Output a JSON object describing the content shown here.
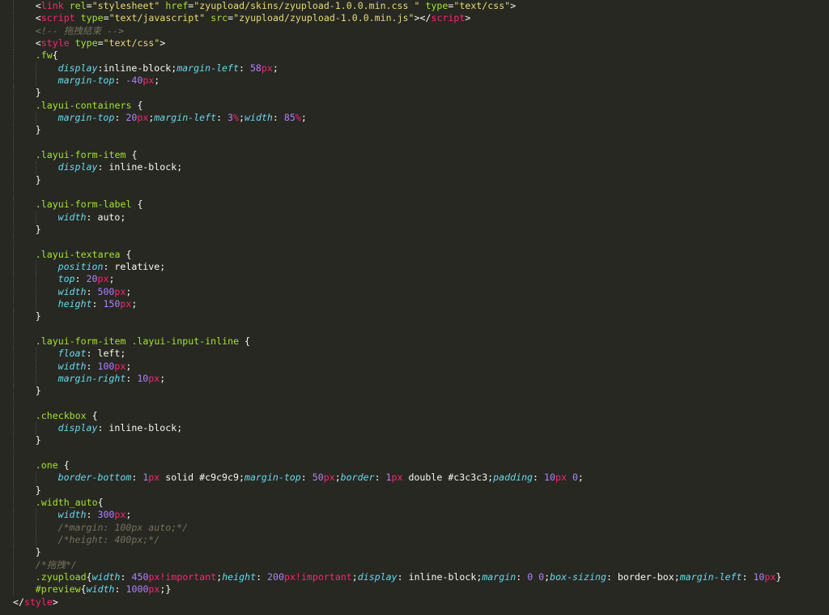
{
  "editor": {
    "theme": "monokai",
    "colors": {
      "background": "#272822",
      "text": "#f8f8f2",
      "tag": "#f92672",
      "attribute": "#a6e22e",
      "string": "#e6db74",
      "comment": "#75715e",
      "property": "#66d9ef",
      "number": "#ae81ff",
      "unit": "#f92672"
    }
  },
  "code_lines": [
    {
      "indent": 1,
      "tokens": [
        [
          "p",
          "<"
        ],
        [
          "t",
          "link"
        ],
        [
          "p",
          " "
        ],
        [
          "a",
          "rel"
        ],
        [
          "p",
          "="
        ],
        [
          "s",
          "\"stylesheet\""
        ],
        [
          "p",
          " "
        ],
        [
          "a",
          "href"
        ],
        [
          "p",
          "="
        ],
        [
          "s",
          "\"zyupload/skins/zyupload-1.0.0.min.css \""
        ],
        [
          "p",
          " "
        ],
        [
          "a",
          "type"
        ],
        [
          "p",
          "="
        ],
        [
          "s",
          "\"text/css\""
        ],
        [
          "p",
          ">"
        ]
      ]
    },
    {
      "indent": 1,
      "tokens": [
        [
          "p",
          "<"
        ],
        [
          "t",
          "script"
        ],
        [
          "p",
          " "
        ],
        [
          "a",
          "type"
        ],
        [
          "p",
          "="
        ],
        [
          "s",
          "\"text/javascript\""
        ],
        [
          "p",
          " "
        ],
        [
          "a",
          "src"
        ],
        [
          "p",
          "="
        ],
        [
          "s",
          "\"zyupload/zyupload-1.0.0.min.js\""
        ],
        [
          "p",
          "></"
        ],
        [
          "t",
          "script"
        ],
        [
          "p",
          ">"
        ]
      ]
    },
    {
      "indent": 1,
      "tokens": [
        [
          "c",
          "<!-- 拖拽結束 -->"
        ]
      ]
    },
    {
      "indent": 1,
      "tokens": [
        [
          "p",
          "<"
        ],
        [
          "t",
          "style"
        ],
        [
          "p",
          " "
        ],
        [
          "a",
          "type"
        ],
        [
          "p",
          "="
        ],
        [
          "s",
          "\"text/css\""
        ],
        [
          "p",
          ">"
        ]
      ]
    },
    {
      "indent": 1,
      "tokens": [
        [
          "a",
          ".fw"
        ],
        [
          "p",
          "{"
        ]
      ]
    },
    {
      "indent": 2,
      "tokens": [
        [
          "k",
          "display"
        ],
        [
          "p",
          ":inline-block;"
        ],
        [
          "k",
          "margin-left"
        ],
        [
          "p",
          ": "
        ],
        [
          "n",
          "58"
        ],
        [
          "u",
          "px"
        ],
        [
          "p",
          ";"
        ]
      ]
    },
    {
      "indent": 2,
      "tokens": [
        [
          "k",
          "margin-top"
        ],
        [
          "p",
          ": "
        ],
        [
          "n",
          "-40"
        ],
        [
          "u",
          "px"
        ],
        [
          "p",
          ";"
        ]
      ]
    },
    {
      "indent": 1,
      "tokens": [
        [
          "p",
          "}"
        ]
      ]
    },
    {
      "indent": 1,
      "tokens": [
        [
          "a",
          ".layui-containers"
        ],
        [
          "p",
          " {"
        ]
      ]
    },
    {
      "indent": 2,
      "tokens": [
        [
          "k",
          "margin-top"
        ],
        [
          "p",
          ": "
        ],
        [
          "n",
          "20"
        ],
        [
          "u",
          "px"
        ],
        [
          "p",
          ";"
        ],
        [
          "k",
          "margin-left"
        ],
        [
          "p",
          ": "
        ],
        [
          "n",
          "3"
        ],
        [
          "u",
          "%"
        ],
        [
          "p",
          ";"
        ],
        [
          "k",
          "width"
        ],
        [
          "p",
          ": "
        ],
        [
          "n",
          "85"
        ],
        [
          "u",
          "%"
        ],
        [
          "p",
          ";"
        ]
      ]
    },
    {
      "indent": 1,
      "tokens": [
        [
          "p",
          "}"
        ]
      ]
    },
    {
      "indent": 1,
      "tokens": []
    },
    {
      "indent": 1,
      "tokens": [
        [
          "a",
          ".layui-form-item"
        ],
        [
          "p",
          " {"
        ]
      ]
    },
    {
      "indent": 2,
      "tokens": [
        [
          "k",
          "display"
        ],
        [
          "p",
          ": inline-block;"
        ]
      ]
    },
    {
      "indent": 1,
      "tokens": [
        [
          "p",
          "}"
        ]
      ]
    },
    {
      "indent": 1,
      "tokens": []
    },
    {
      "indent": 1,
      "tokens": [
        [
          "a",
          ".layui-form-label"
        ],
        [
          "p",
          " {"
        ]
      ]
    },
    {
      "indent": 2,
      "tokens": [
        [
          "k",
          "width"
        ],
        [
          "p",
          ": auto;"
        ]
      ]
    },
    {
      "indent": 1,
      "tokens": [
        [
          "p",
          "}"
        ]
      ]
    },
    {
      "indent": 1,
      "tokens": []
    },
    {
      "indent": 1,
      "tokens": [
        [
          "a",
          ".layui-textarea"
        ],
        [
          "p",
          " {"
        ]
      ]
    },
    {
      "indent": 2,
      "tokens": [
        [
          "k",
          "position"
        ],
        [
          "p",
          ": relative;"
        ]
      ]
    },
    {
      "indent": 2,
      "tokens": [
        [
          "k",
          "top"
        ],
        [
          "p",
          ": "
        ],
        [
          "n",
          "20"
        ],
        [
          "u",
          "px"
        ],
        [
          "p",
          ";"
        ]
      ]
    },
    {
      "indent": 2,
      "tokens": [
        [
          "k",
          "width"
        ],
        [
          "p",
          ": "
        ],
        [
          "n",
          "500"
        ],
        [
          "u",
          "px"
        ],
        [
          "p",
          ";"
        ]
      ]
    },
    {
      "indent": 2,
      "tokens": [
        [
          "k",
          "height"
        ],
        [
          "p",
          ": "
        ],
        [
          "n",
          "150"
        ],
        [
          "u",
          "px"
        ],
        [
          "p",
          ";"
        ]
      ]
    },
    {
      "indent": 1,
      "tokens": [
        [
          "p",
          "}"
        ]
      ]
    },
    {
      "indent": 1,
      "tokens": []
    },
    {
      "indent": 1,
      "tokens": [
        [
          "a",
          ".layui-form-item .layui-input-inline"
        ],
        [
          "p",
          " {"
        ]
      ]
    },
    {
      "indent": 2,
      "tokens": [
        [
          "k",
          "float"
        ],
        [
          "p",
          ": left;"
        ]
      ]
    },
    {
      "indent": 2,
      "tokens": [
        [
          "k",
          "width"
        ],
        [
          "p",
          ": "
        ],
        [
          "n",
          "100"
        ],
        [
          "u",
          "px"
        ],
        [
          "p",
          ";"
        ]
      ]
    },
    {
      "indent": 2,
      "tokens": [
        [
          "k",
          "margin-right"
        ],
        [
          "p",
          ": "
        ],
        [
          "n",
          "10"
        ],
        [
          "u",
          "px"
        ],
        [
          "p",
          ";"
        ]
      ]
    },
    {
      "indent": 1,
      "tokens": [
        [
          "p",
          "}"
        ]
      ]
    },
    {
      "indent": 1,
      "tokens": []
    },
    {
      "indent": 1,
      "tokens": [
        [
          "a",
          ".checkbox"
        ],
        [
          "p",
          " {"
        ]
      ]
    },
    {
      "indent": 2,
      "tokens": [
        [
          "k",
          "display"
        ],
        [
          "p",
          ": inline-block;"
        ]
      ]
    },
    {
      "indent": 1,
      "tokens": [
        [
          "p",
          "}"
        ]
      ]
    },
    {
      "indent": 1,
      "tokens": []
    },
    {
      "indent": 1,
      "tokens": [
        [
          "a",
          ".one"
        ],
        [
          "p",
          " {"
        ]
      ]
    },
    {
      "indent": 2,
      "tokens": [
        [
          "k",
          "border-bottom"
        ],
        [
          "p",
          ": "
        ],
        [
          "n",
          "1"
        ],
        [
          "u",
          "px"
        ],
        [
          "p",
          " solid #c9c9c9;"
        ],
        [
          "k",
          "margin-top"
        ],
        [
          "p",
          ": "
        ],
        [
          "n",
          "50"
        ],
        [
          "u",
          "px"
        ],
        [
          "p",
          ";"
        ],
        [
          "k",
          "border"
        ],
        [
          "p",
          ": "
        ],
        [
          "n",
          "1"
        ],
        [
          "u",
          "px"
        ],
        [
          "p",
          " double #c3c3c3;"
        ],
        [
          "k",
          "padding"
        ],
        [
          "p",
          ": "
        ],
        [
          "n",
          "10"
        ],
        [
          "u",
          "px"
        ],
        [
          "p",
          " "
        ],
        [
          "n",
          "0"
        ],
        [
          "p",
          ";"
        ]
      ]
    },
    {
      "indent": 1,
      "tokens": [
        [
          "p",
          "}"
        ]
      ]
    },
    {
      "indent": 1,
      "tokens": [
        [
          "a",
          ".width_auto"
        ],
        [
          "p",
          "{"
        ]
      ]
    },
    {
      "indent": 2,
      "tokens": [
        [
          "k",
          "width"
        ],
        [
          "p",
          ": "
        ],
        [
          "n",
          "300"
        ],
        [
          "u",
          "px"
        ],
        [
          "p",
          ";"
        ]
      ]
    },
    {
      "indent": 2,
      "tokens": [
        [
          "c",
          "/*margin: 100px auto;*/"
        ]
      ]
    },
    {
      "indent": 2,
      "tokens": [
        [
          "c",
          "/*height: 400px;*/"
        ]
      ]
    },
    {
      "indent": 1,
      "tokens": [
        [
          "p",
          "}"
        ]
      ]
    },
    {
      "indent": 1,
      "tokens": [
        [
          "c",
          "/*拖拽*/"
        ]
      ]
    },
    {
      "indent": 1,
      "tokens": [
        [
          "a",
          ".zyupload"
        ],
        [
          "p",
          "{"
        ],
        [
          "k",
          "width"
        ],
        [
          "p",
          ": "
        ],
        [
          "n",
          "450"
        ],
        [
          "u",
          "px!important"
        ],
        [
          "p",
          ";"
        ],
        [
          "k",
          "height"
        ],
        [
          "p",
          ": "
        ],
        [
          "n",
          "200"
        ],
        [
          "u",
          "px!important"
        ],
        [
          "p",
          ";"
        ],
        [
          "k",
          "display"
        ],
        [
          "p",
          ": inline-block;"
        ],
        [
          "k",
          "margin"
        ],
        [
          "p",
          ": "
        ],
        [
          "n",
          "0"
        ],
        [
          "p",
          " "
        ],
        [
          "n",
          "0"
        ],
        [
          "p",
          ";"
        ],
        [
          "k",
          "box-sizing"
        ],
        [
          "p",
          ": border-box;"
        ],
        [
          "k",
          "margin-left"
        ],
        [
          "p",
          ": "
        ],
        [
          "n",
          "10"
        ],
        [
          "u",
          "px"
        ],
        [
          "p",
          "}"
        ]
      ]
    },
    {
      "indent": 1,
      "tokens": [
        [
          "a",
          "#preview"
        ],
        [
          "p",
          "{"
        ],
        [
          "k",
          "width"
        ],
        [
          "p",
          ": "
        ],
        [
          "n",
          "1000"
        ],
        [
          "u",
          "px"
        ],
        [
          "p",
          ";}"
        ]
      ]
    },
    {
      "indent": 0,
      "tokens": [
        [
          "p",
          "</"
        ],
        [
          "t",
          "style"
        ],
        [
          "p",
          ">"
        ]
      ]
    }
  ]
}
